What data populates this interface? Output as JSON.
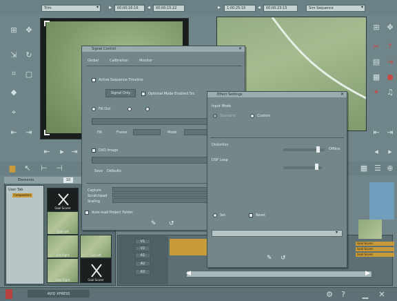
{
  "toolbar": {
    "mode_select": "Trim",
    "in_tc": "00:00:16:16",
    "out_tc": "00:00:15:22",
    "right_in_tc": "1:00:25:16",
    "right_out_tc": "00:00:23:15",
    "fast_menu": "Sim Sequence"
  },
  "signal_dialog": {
    "title": "Signal Control",
    "tabs": [
      "Global",
      "Calibration",
      "Monitor"
    ],
    "check_option": "Active Sequence Timeline",
    "button_label": "Signal Only",
    "secondary_check": "Optional Mode Enabled Src",
    "opt1": "Fill Out",
    "field1_label": "Frame",
    "field2_label": "Mode",
    "field3_label": "Fill",
    "opt2": "DVD Image",
    "field4_label": "Save",
    "field4_value": "Defaults",
    "row_labels": [
      "Capture",
      "Scratchpad",
      "Scaling"
    ],
    "footer_check": "Auto-load Project Folder"
  },
  "effect_dialog": {
    "title": "Effect Settings",
    "section": "Input Mode",
    "radio1": "Standard",
    "radio2": "Custom",
    "row1": "Distortion",
    "row1_value": "Offline",
    "row2": "DSP Loop",
    "radio3": "Set",
    "radio4": "Reset"
  },
  "bin": {
    "header": "Elements",
    "count": "10",
    "tree_item1": "User Tab",
    "tree_item2": "Composition",
    "thumbs": [
      "Goal Scorer",
      "Goal Left",
      "Cut Right",
      "Cut Left",
      "Goal Right",
      "Goal Scorer"
    ]
  },
  "timeline": {
    "tracks": [
      "V1",
      "V2",
      "A1",
      "A2",
      "A3"
    ],
    "clip_labels": [
      "Goal Scorer",
      "Goal Scorer",
      "Goal Scorer"
    ]
  },
  "statusbar": {
    "app_name": "AVID XPRESS"
  }
}
